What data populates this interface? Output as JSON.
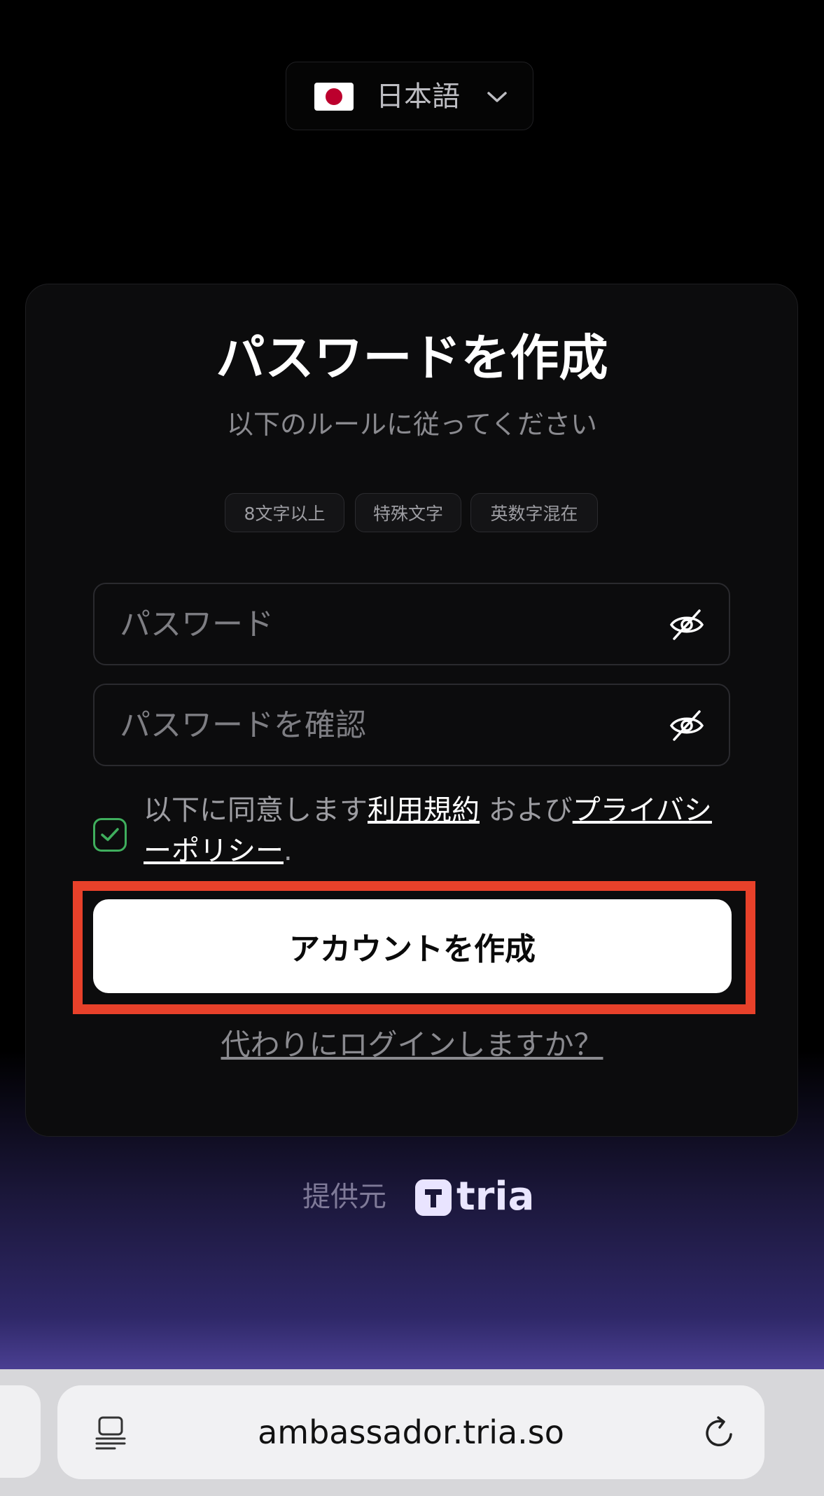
{
  "language": {
    "label": "日本語"
  },
  "card": {
    "title": "パスワードを作成",
    "subtitle": "以下のルールに従ってください",
    "rules": [
      "8文字以上",
      "特殊文字",
      "英数字混在"
    ],
    "password": {
      "placeholder": "パスワード",
      "value": ""
    },
    "confirm": {
      "placeholder": "パスワードを確認",
      "value": ""
    },
    "agreement": {
      "checked": true,
      "prefix": "以下に同意します",
      "terms": "利用規約",
      "and": " および",
      "privacy": "プライバシーポリシー",
      "suffix": "."
    },
    "create_button": "アカウントを作成",
    "login_link": "代わりにログインしますか？"
  },
  "powered_by": {
    "label": "提供元",
    "brand": "tria"
  },
  "browser": {
    "url": "ambassador.tria.so"
  },
  "colors": {
    "highlight": "#e8412a",
    "checkbox": "#3fae5d",
    "brand_tint": "#e9e4ff"
  },
  "icons": {
    "language_flag": "japan-flag-icon",
    "language_dropdown": "chevron-down-icon",
    "password_toggle": "eye-off-icon",
    "checkbox": "check-icon",
    "brand": "tria-logo-icon",
    "reader": "reader-mode-icon",
    "reload": "reload-icon"
  }
}
